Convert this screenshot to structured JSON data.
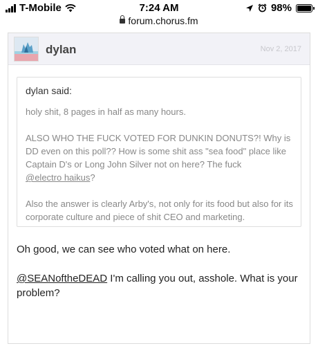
{
  "status_bar": {
    "carrier": "T-Mobile",
    "time": "7:24 AM",
    "battery": "98%",
    "battery_level": 0.98
  },
  "browser": {
    "url": "forum.chorus.fm"
  },
  "post": {
    "username": "dylan",
    "date": "Nov 2, 2017",
    "quote": {
      "author": "dylan said:",
      "p1": "holy shit, 8 pages in half as many hours.",
      "p2": "ALSO WHO THE FUCK VOTED FOR DUNKIN DONUTS?! Why is DD even on this poll?? How is some shit ass \"sea food\" place like Captain D's or Long John Silver not on here? The fuck",
      "p2_mention": "@electro haikus",
      "p2_end": "?",
      "p3": "Also the answer is clearly Arby's, not only for its food but also for its corporate culture and piece of shit CEO and marketing."
    },
    "message": {
      "line1": "Oh good, we can see who voted what on here.",
      "mention": "@SEANoftheDEAD",
      "line2_rest": " I'm calling you out, asshole. What is your problem?"
    }
  },
  "icons": [
    "wifi-icon",
    "lock-icon",
    "location-icon",
    "alarm-icon",
    "battery-icon"
  ],
  "colors": {
    "header_bg": "#f2f2f7",
    "quote_text": "#888888",
    "date_text": "#c7c7cc"
  }
}
